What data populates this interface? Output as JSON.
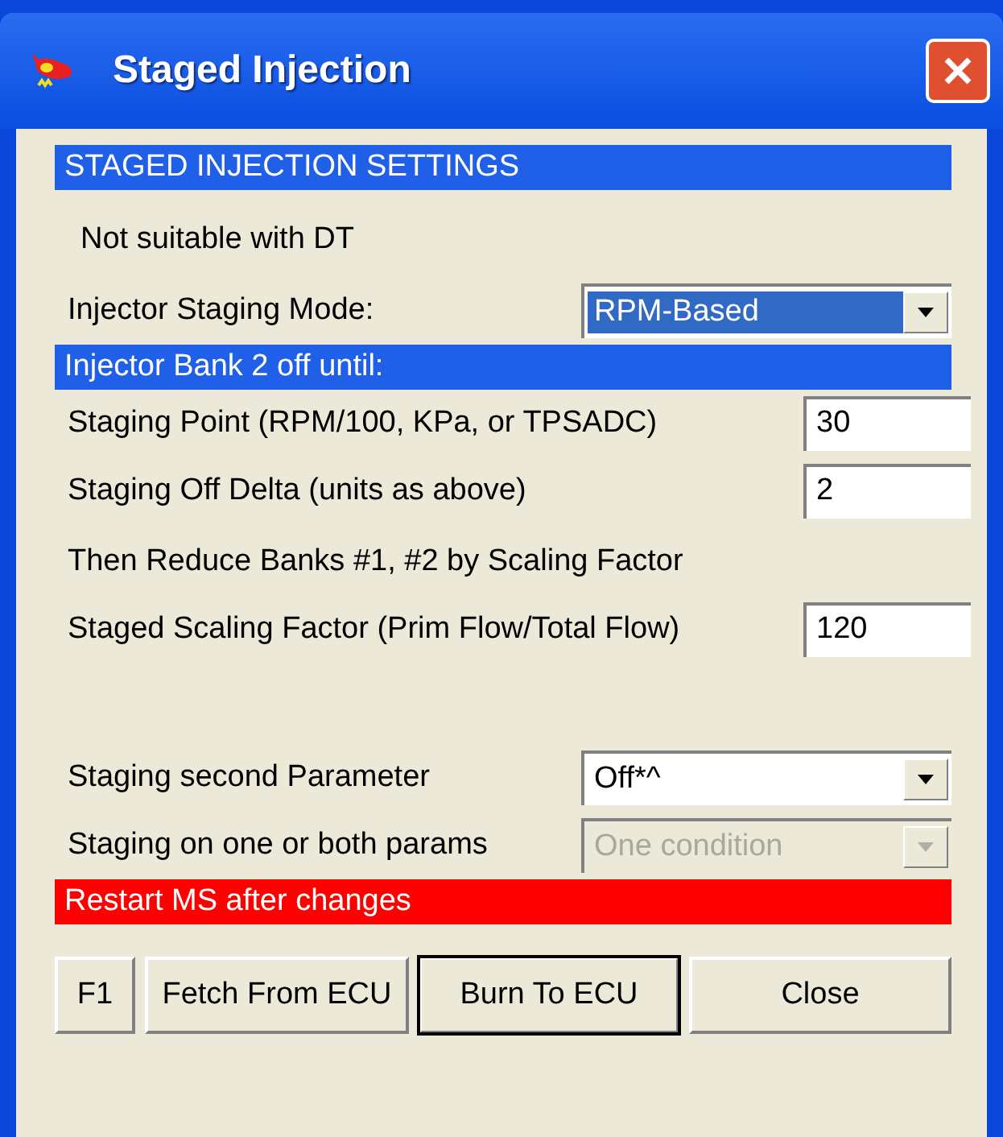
{
  "window": {
    "title": "Staged Injection"
  },
  "rows": [
    {
      "kind": "header",
      "text": "STAGED INJECTION SETTINGS",
      "color": "#2060e8"
    },
    {
      "kind": "note",
      "text": "Not suitable with DT"
    },
    {
      "kind": "select",
      "label": "Injector Staging Mode:",
      "value": "RPM-Based",
      "disabled": false,
      "selected": true
    },
    {
      "kind": "header",
      "text": "Injector Bank 2 off until:",
      "color": "#2060e8"
    },
    {
      "kind": "input",
      "label": "Staging Point (RPM/100, KPa, or TPSADC)",
      "value": "30"
    },
    {
      "kind": "input",
      "label": "Staging Off Delta (units as above)",
      "value": "2"
    },
    {
      "kind": "text",
      "text": "Then Reduce Banks #1, #2 by Scaling Factor"
    },
    {
      "kind": "input",
      "label": "Staged Scaling Factor (Prim Flow/Total Flow)",
      "value": "120"
    },
    {
      "kind": "spacer"
    },
    {
      "kind": "select",
      "label": "Staging second Parameter",
      "value": "Off*^",
      "disabled": false,
      "selected": false
    },
    {
      "kind": "select",
      "label": "Staging on one or both params",
      "value": "One condition",
      "disabled": true,
      "selected": false
    },
    {
      "kind": "header",
      "text": "Restart MS after changes",
      "color": "#ff0000"
    }
  ],
  "buttons": [
    {
      "label": "F1",
      "default": false
    },
    {
      "label": "Fetch From ECU",
      "default": false
    },
    {
      "label": "Burn To ECU",
      "default": true
    },
    {
      "label": "Close",
      "default": false
    }
  ]
}
